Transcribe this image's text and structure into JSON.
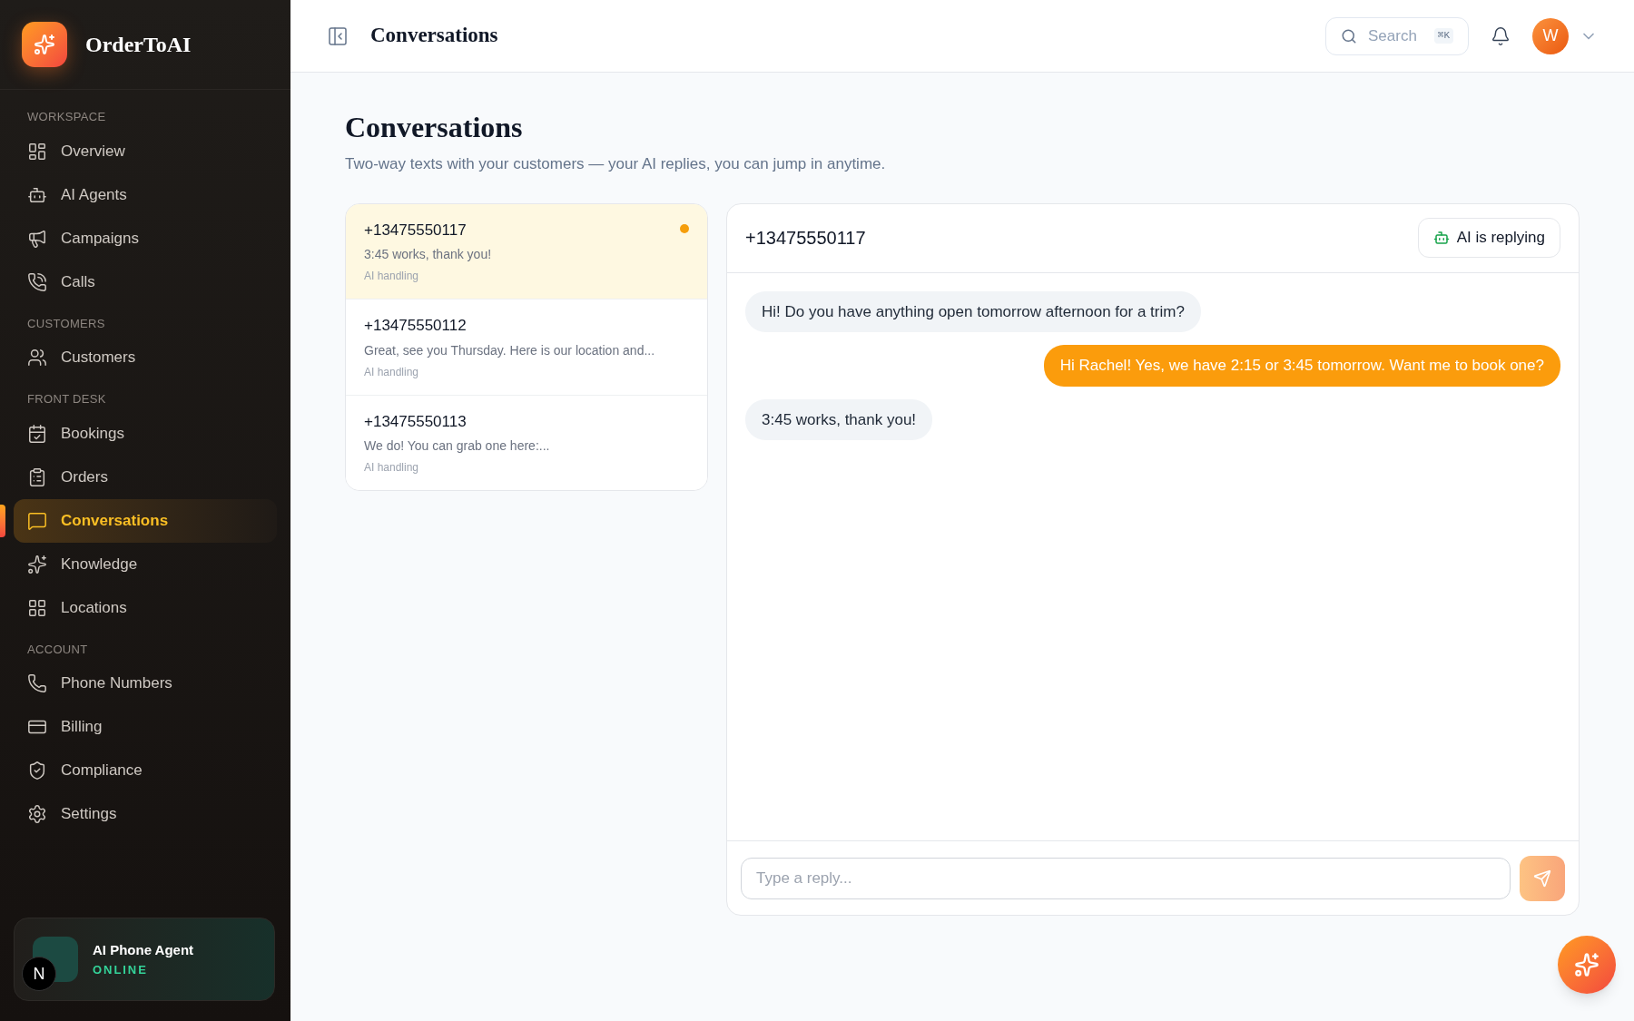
{
  "brand": {
    "name": "OrderToAI"
  },
  "sidebar": {
    "sections": [
      {
        "title": "WORKSPACE",
        "items": [
          {
            "label": "Overview",
            "selected": false
          },
          {
            "label": "AI Agents",
            "selected": false
          },
          {
            "label": "Campaigns",
            "selected": false
          },
          {
            "label": "Calls",
            "selected": false
          }
        ]
      },
      {
        "title": "CUSTOMERS",
        "items": [
          {
            "label": "Customers",
            "selected": false
          }
        ]
      },
      {
        "title": "FRONT DESK",
        "items": [
          {
            "label": "Bookings",
            "selected": false
          },
          {
            "label": "Orders",
            "selected": false
          },
          {
            "label": "Conversations",
            "selected": true
          },
          {
            "label": "Knowledge",
            "selected": false
          },
          {
            "label": "Locations",
            "selected": false
          }
        ]
      },
      {
        "title": "ACCOUNT",
        "items": [
          {
            "label": "Phone Numbers",
            "selected": false
          },
          {
            "label": "Billing",
            "selected": false
          },
          {
            "label": "Compliance",
            "selected": false
          },
          {
            "label": "Settings",
            "selected": false
          }
        ]
      }
    ]
  },
  "agent_card": {
    "title": "AI Phone Agent",
    "status": "ONLINE",
    "badge": "N"
  },
  "topbar": {
    "title": "Conversations",
    "search": {
      "placeholder": "Search",
      "shortcut": "⌘K"
    },
    "avatar": "W"
  },
  "page": {
    "title": "Conversations",
    "subtitle": "Two-way texts with your customers — your AI replies, you can jump in anytime."
  },
  "conversations": [
    {
      "phone": "+13475550117",
      "preview": "3:45 works, thank you!",
      "status": "AI handling",
      "selected": true,
      "unread": true
    },
    {
      "phone": "+13475550112",
      "preview": "Great, see you Thursday. Here is our location and...",
      "status": "AI handling",
      "selected": false,
      "unread": false
    },
    {
      "phone": "+13475550113",
      "preview": "We do! You can grab one here:...",
      "status": "AI handling",
      "selected": false,
      "unread": false
    }
  ],
  "chat": {
    "phone": "+13475550117",
    "ai_status": "AI is replying",
    "messages": [
      {
        "kind": "incoming",
        "text": "Hi! Do you have anything open tomorrow afternoon for a trim?"
      },
      {
        "kind": "outgoing",
        "text": "Hi Rachel! Yes, we have 2:15 or 3:45 tomorrow. Want me to book one?"
      },
      {
        "kind": "incoming",
        "text": "3:45 works, thank you!"
      }
    ],
    "reply": {
      "placeholder": "Type a reply..."
    }
  }
}
